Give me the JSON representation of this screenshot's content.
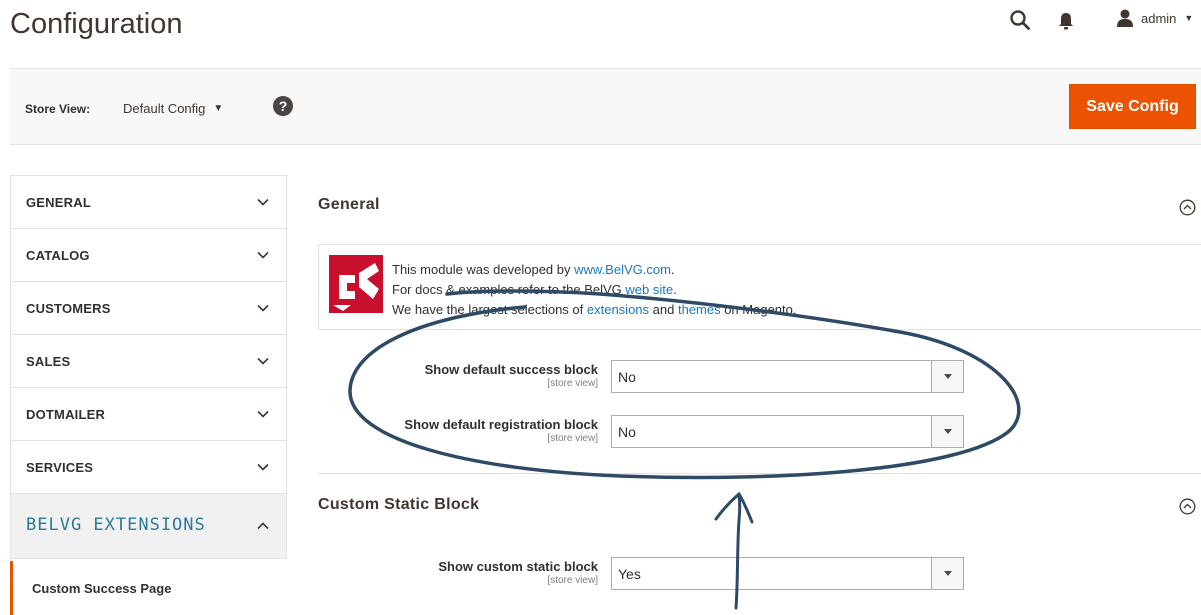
{
  "header": {
    "title": "Configuration",
    "icons": [
      "search-icon",
      "bell-icon",
      "user-icon"
    ],
    "admin_label": "admin"
  },
  "store_bar": {
    "label": "Store View:",
    "selected": "Default Config",
    "help_icon": "?",
    "save_label": "Save Config"
  },
  "sidebar": {
    "items": [
      {
        "label": "GENERAL"
      },
      {
        "label": "CATALOG"
      },
      {
        "label": "CUSTOMERS"
      },
      {
        "label": "SALES"
      },
      {
        "label": "DOTMAILER"
      },
      {
        "label": "SERVICES"
      },
      {
        "label": "BELVG EXTENSIONS"
      }
    ],
    "sub_item": "Custom Success Page"
  },
  "general": {
    "title": "General",
    "info": {
      "line1_prefix": "This module was developed by ",
      "line1_link": "www.BelVG.com",
      "line1_suffix": ".",
      "line2_prefix": "For docs & examples refer to the BelVG ",
      "line2_link": "web site",
      "line2_suffix": ".",
      "line3_prefix": "We have the largest selections of ",
      "line3_link1": "extensions",
      "line3_mid": " and ",
      "line3_link2": "themes",
      "line3_suffix": " on Magento."
    },
    "fields": [
      {
        "label": "Show default success block",
        "scope": "[store view]",
        "value": "No"
      },
      {
        "label": "Show default registration block",
        "scope": "[store view]",
        "value": "No"
      }
    ]
  },
  "custom_static": {
    "title": "Custom Static Block",
    "fields": [
      {
        "label": "Show custom static block",
        "scope": "[store view]",
        "value": "Yes"
      }
    ]
  },
  "colors": {
    "accent": "#eb5202",
    "link": "#1979c3",
    "annotation": "#2f4a66"
  }
}
